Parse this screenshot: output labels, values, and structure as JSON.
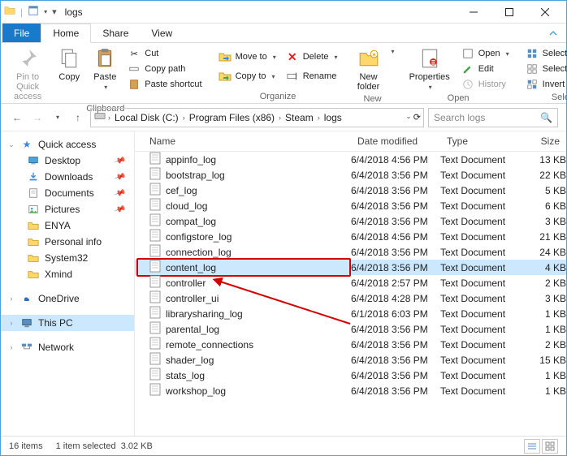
{
  "window": {
    "title": "logs"
  },
  "tabs": {
    "file": "File",
    "home": "Home",
    "share": "Share",
    "view": "View"
  },
  "ribbon": {
    "clipboard": {
      "label": "Clipboard",
      "pin": "Pin to Quick\naccess",
      "copy": "Copy",
      "paste": "Paste",
      "cut": "Cut",
      "copy_path": "Copy path",
      "paste_shortcut": "Paste shortcut"
    },
    "organize": {
      "label": "Organize",
      "move_to": "Move to",
      "copy_to": "Copy to",
      "delete": "Delete",
      "rename": "Rename"
    },
    "new": {
      "label": "New",
      "new_folder": "New\nfolder"
    },
    "open": {
      "label": "Open",
      "properties": "Properties",
      "open": "Open",
      "edit": "Edit",
      "history": "History"
    },
    "select": {
      "label": "Select",
      "select_all": "Select all",
      "select_none": "Select none",
      "invert": "Invert selection"
    }
  },
  "breadcrumbs": [
    "Local Disk (C:)",
    "Program Files (x86)",
    "Steam",
    "logs"
  ],
  "search": {
    "placeholder": "Search logs"
  },
  "sidebar": {
    "quick_access": "Quick access",
    "items": [
      {
        "label": "Desktop",
        "pin": true,
        "icon": "desktop"
      },
      {
        "label": "Downloads",
        "pin": true,
        "icon": "downloads"
      },
      {
        "label": "Documents",
        "pin": true,
        "icon": "documents"
      },
      {
        "label": "Pictures",
        "pin": true,
        "icon": "pictures"
      },
      {
        "label": "ENYA",
        "pin": false,
        "icon": "folder"
      },
      {
        "label": "Personal info",
        "pin": false,
        "icon": "folder"
      },
      {
        "label": "System32",
        "pin": false,
        "icon": "folder"
      },
      {
        "label": "Xmind",
        "pin": false,
        "icon": "folder"
      }
    ],
    "onedrive": "OneDrive",
    "this_pc": "This PC",
    "network": "Network"
  },
  "columns": {
    "name": "Name",
    "date": "Date modified",
    "type": "Type",
    "size": "Size"
  },
  "files": [
    {
      "name": "appinfo_log",
      "date": "6/4/2018 4:56 PM",
      "type": "Text Document",
      "size": "13 KB"
    },
    {
      "name": "bootstrap_log",
      "date": "6/4/2018 3:56 PM",
      "type": "Text Document",
      "size": "22 KB"
    },
    {
      "name": "cef_log",
      "date": "6/4/2018 3:56 PM",
      "type": "Text Document",
      "size": "5 KB"
    },
    {
      "name": "cloud_log",
      "date": "6/4/2018 3:56 PM",
      "type": "Text Document",
      "size": "6 KB"
    },
    {
      "name": "compat_log",
      "date": "6/4/2018 3:56 PM",
      "type": "Text Document",
      "size": "3 KB"
    },
    {
      "name": "configstore_log",
      "date": "6/4/2018 4:56 PM",
      "type": "Text Document",
      "size": "21 KB"
    },
    {
      "name": "connection_log",
      "date": "6/4/2018 3:56 PM",
      "type": "Text Document",
      "size": "24 KB"
    },
    {
      "name": "content_log",
      "date": "6/4/2018 3:56 PM",
      "type": "Text Document",
      "size": "4 KB",
      "selected": true
    },
    {
      "name": "controller",
      "date": "6/4/2018 2:57 PM",
      "type": "Text Document",
      "size": "2 KB"
    },
    {
      "name": "controller_ui",
      "date": "6/4/2018 4:28 PM",
      "type": "Text Document",
      "size": "3 KB"
    },
    {
      "name": "librarysharing_log",
      "date": "6/1/2018 6:03 PM",
      "type": "Text Document",
      "size": "1 KB"
    },
    {
      "name": "parental_log",
      "date": "6/4/2018 3:56 PM",
      "type": "Text Document",
      "size": "1 KB"
    },
    {
      "name": "remote_connections",
      "date": "6/4/2018 3:56 PM",
      "type": "Text Document",
      "size": "2 KB"
    },
    {
      "name": "shader_log",
      "date": "6/4/2018 3:56 PM",
      "type": "Text Document",
      "size": "15 KB"
    },
    {
      "name": "stats_log",
      "date": "6/4/2018 3:56 PM",
      "type": "Text Document",
      "size": "1 KB"
    },
    {
      "name": "workshop_log",
      "date": "6/4/2018 3:56 PM",
      "type": "Text Document",
      "size": "1 KB"
    }
  ],
  "status": {
    "count": "16 items",
    "selected": "1 item selected",
    "size": "3.02 KB"
  },
  "colors": {
    "accent": "#1979ca",
    "selection": "#cce8ff",
    "highlight_border": "#d40000"
  }
}
